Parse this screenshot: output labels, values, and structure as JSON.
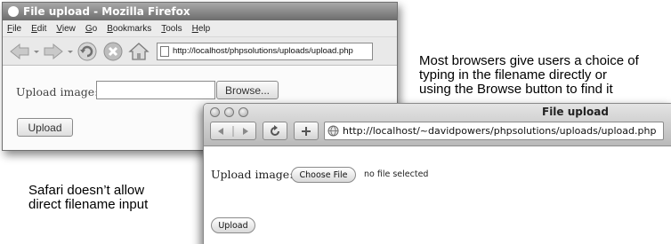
{
  "firefox": {
    "title": "File upload - Mozilla Firefox",
    "menu": [
      "File",
      "Edit",
      "View",
      "Go",
      "Bookmarks",
      "Tools",
      "Help"
    ],
    "url": "http://localhost/phpsolutions/uploads/upload.php",
    "form": {
      "label": "Upload image:",
      "file_value": "",
      "browse_label": "Browse...",
      "upload_label": "Upload"
    }
  },
  "safari": {
    "title": "File upload",
    "url": "http://localhost/~davidpowers/phpsolutions/uploads/upload.php",
    "form": {
      "label": "Upload image:",
      "choose_label": "Choose File",
      "status": "no file selected",
      "upload_label": "Upload"
    }
  },
  "captions": {
    "firefox": [
      "Most browsers give users a choice of",
      "typing in the filename directly or",
      "using the Browse button to find it"
    ],
    "safari": [
      "Safari doesn’t allow",
      "direct filename input"
    ]
  }
}
